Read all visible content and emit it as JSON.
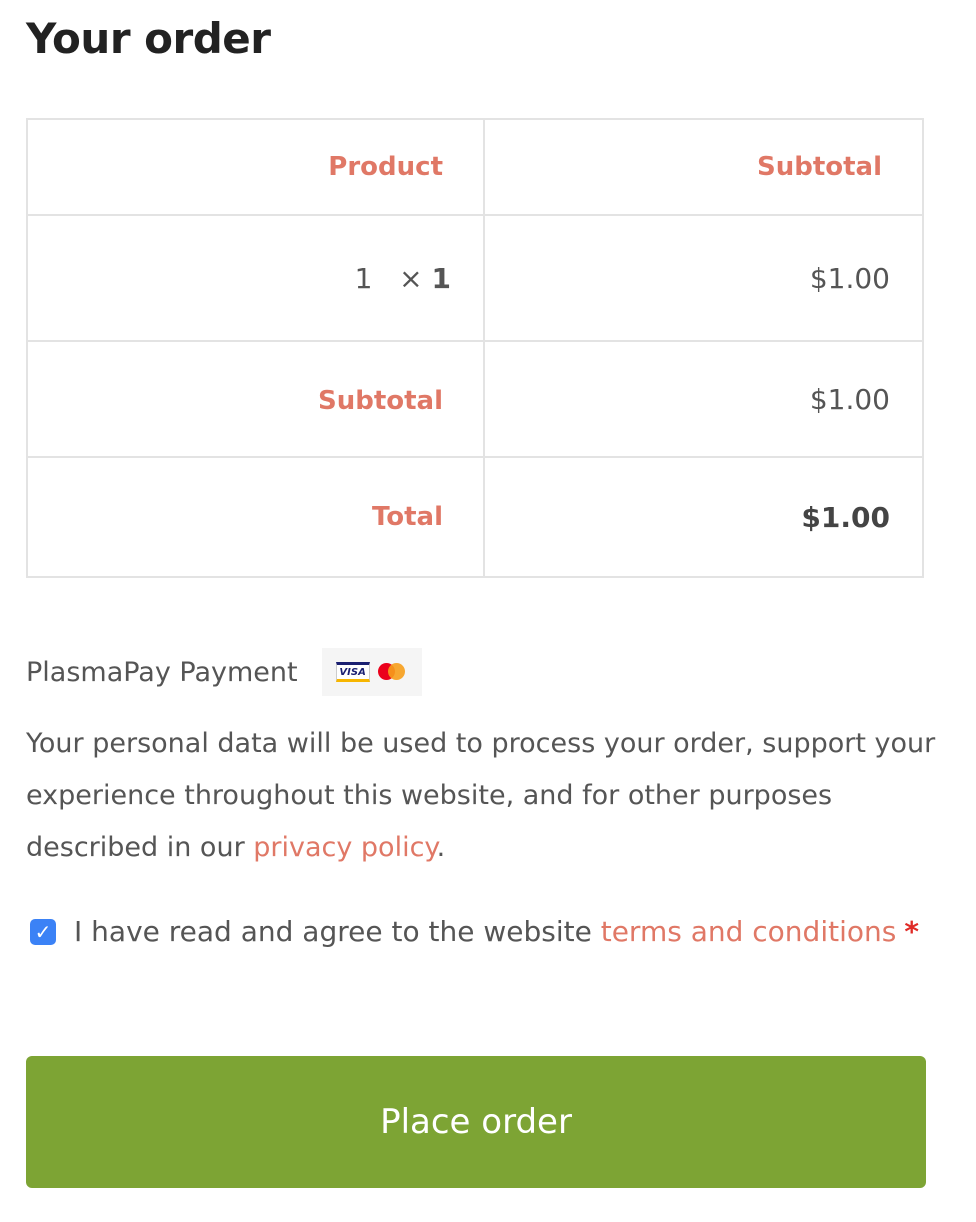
{
  "heading": "Your order",
  "table": {
    "headers": {
      "product": "Product",
      "subtotal": "Subtotal"
    },
    "items": [
      {
        "name": "1",
        "times": "×",
        "qty": "1",
        "subtotal": "$1.00"
      }
    ],
    "subtotal_label": "Subtotal",
    "subtotal_value": "$1.00",
    "total_label": "Total",
    "total_value": "$1.00"
  },
  "payment": {
    "method_label": "PlasmaPay Payment",
    "card_icons": [
      "visa-icon",
      "mastercard-icon"
    ],
    "visa_text": "VISA"
  },
  "privacy": {
    "text": "Your personal data will be used to process your order, support your experience throughout this website, and for other purposes described in our ",
    "link": "privacy policy",
    "end": "."
  },
  "terms": {
    "checked": true,
    "text": "I have read and agree to the website ",
    "link": "terms and conditions",
    "required": "*"
  },
  "place_order": "Place order",
  "colors": {
    "accent": "#e07866",
    "button": "#7da434",
    "checkbox": "#3b82f6",
    "required": "#e02b27"
  }
}
